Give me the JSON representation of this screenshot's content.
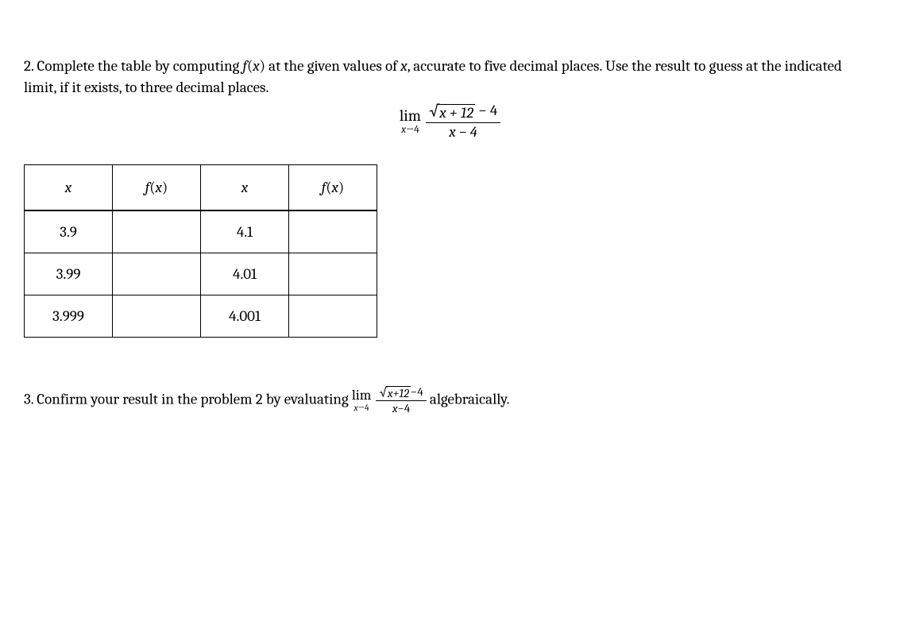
{
  "problem2": {
    "prefix": "2.  Complete the table by computing ",
    "fx": "f",
    "fx_arg_open": "(",
    "fx_var": "x",
    "fx_arg_close": ")",
    "mid1": " at the given values of ",
    "var_x": "x",
    "mid2": ", accurate to five decimal places. Use the result to guess at the indicated limit, if it exists, to three decimal places."
  },
  "limit": {
    "lim_label": "lim",
    "lim_sub_var": "x",
    "lim_sub_arrow": "→",
    "lim_sub_val": "4",
    "num_sqrt_sign": "√",
    "num_sqrt_body": "x + 12",
    "num_rest": " − 4",
    "den": "x − 4"
  },
  "table": {
    "headers": {
      "x1": "x",
      "fx1_f": "f",
      "fx1_open": "(",
      "fx1_x": "x",
      "fx1_close": ")",
      "x2": "x",
      "fx2_f": "f",
      "fx2_open": "(",
      "fx2_x": "x",
      "fx2_close": ")"
    },
    "rows": [
      {
        "xL": "3.9",
        "fxL": "",
        "xR": "4.1",
        "fxR": ""
      },
      {
        "xL": "3.99",
        "fxL": "",
        "xR": "4.01",
        "fxR": ""
      },
      {
        "xL": "3.999",
        "fxL": "",
        "xR": "4.001",
        "fxR": ""
      }
    ]
  },
  "problem3": {
    "prefix": "3. Confirm your result in the problem 2 by evaluating ",
    "suffix": " algebraically."
  }
}
